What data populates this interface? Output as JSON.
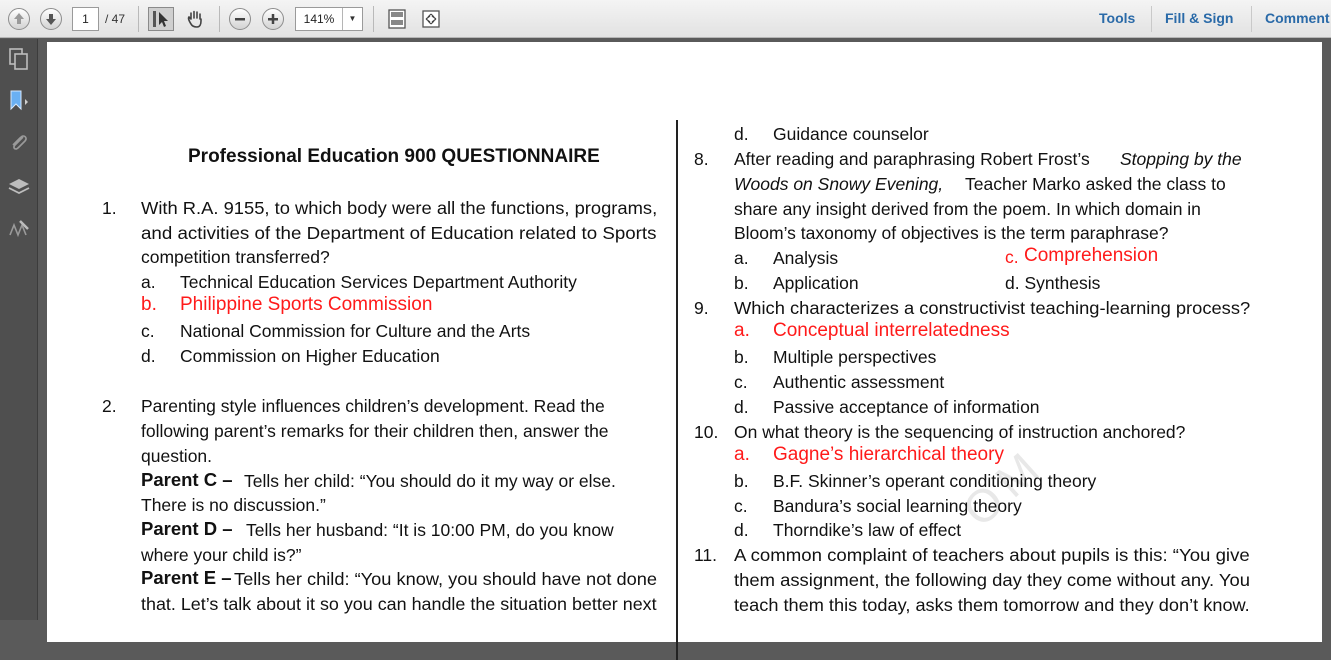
{
  "toolbar": {
    "page_current": "1",
    "page_total": "/ 47",
    "zoom": "141%",
    "links": [
      "Tools",
      "Fill & Sign",
      "Comment"
    ]
  },
  "icons": {
    "prev": "arrow-up-icon",
    "next": "arrow-down-icon",
    "select": "select-cursor-icon",
    "hand": "hand-icon",
    "zoom_out": "minus-icon",
    "zoom_in": "plus-icon",
    "fit_page": "fit-page-icon",
    "full": "fullscreen-icon",
    "pages": "pages-icon",
    "bookmarks": "bookmark-icon",
    "attachments": "paperclip-icon",
    "layers": "layers-icon",
    "sign": "signature-icon"
  },
  "colors": {
    "answer": "#ff1a1a",
    "link": "#2a6aa8"
  },
  "doc": {
    "title": "Professional Education 900 QUESTIONNAIRE",
    "left": [
      "1.",
      "With R.A. 9155, to which body were all the functions, programs,",
      "and activities of the Department of Education related to Sports",
      "competition transferred?",
      "a.",
      "Technical Education Services Department Authority",
      "b.",
      "Philippine Sports Commission",
      "c.",
      "National Commission for Culture and the Arts",
      "d.",
      "Commission on Higher Education",
      "2.",
      "Parenting style influences children’s development. Read the",
      "following parent’s remarks for their children then, answer the",
      "question.",
      "Parent C –",
      "Tells her child: “You should do it my way or else.",
      "There is no discussion.”",
      "Parent D –",
      "Tells her husband: “It is 10:00 PM, do you know",
      "where your child is?”",
      "Parent E –",
      "Tells her child: “You know, you should have not done",
      "that. Let’s talk about it so you can handle the situation better next"
    ],
    "right": [
      "d.",
      "Guidance counselor",
      "8.",
      "After reading and paraphrasing Robert Frost’s",
      "Stopping by the",
      "Woods on Snowy Evening,",
      "Teacher Marko asked the class to",
      "share any insight derived from the poem. In which domain in",
      "Bloom’s taxonomy of objectives is the term paraphrase?",
      "a.",
      "Analysis",
      "c.",
      "Comprehension",
      "b.",
      "Application",
      "d. Synthesis",
      "9.",
      "Which characterizes a constructivist teaching-learning process?",
      "a.",
      "Conceptual interrelatedness",
      "b.",
      "Multiple perspectives",
      "c.",
      "Authentic assessment",
      "d.",
      "Passive acceptance of information",
      "10.",
      "On what theory is the sequencing of instruction anchored?",
      "a.",
      "Gagne’s hierarchical theory",
      "b.",
      "B.F. Skinner’s operant conditioning theory",
      "c.",
      "Bandura’s social learning theory",
      "d.",
      "Thorndike’s law of effect",
      "11.",
      "A common complaint of teachers about pupils is this: “You give",
      "them assignment, the following day they come without any. You",
      "teach them this today, asks them tomorrow and they don’t know."
    ],
    "watermark": "OM"
  }
}
